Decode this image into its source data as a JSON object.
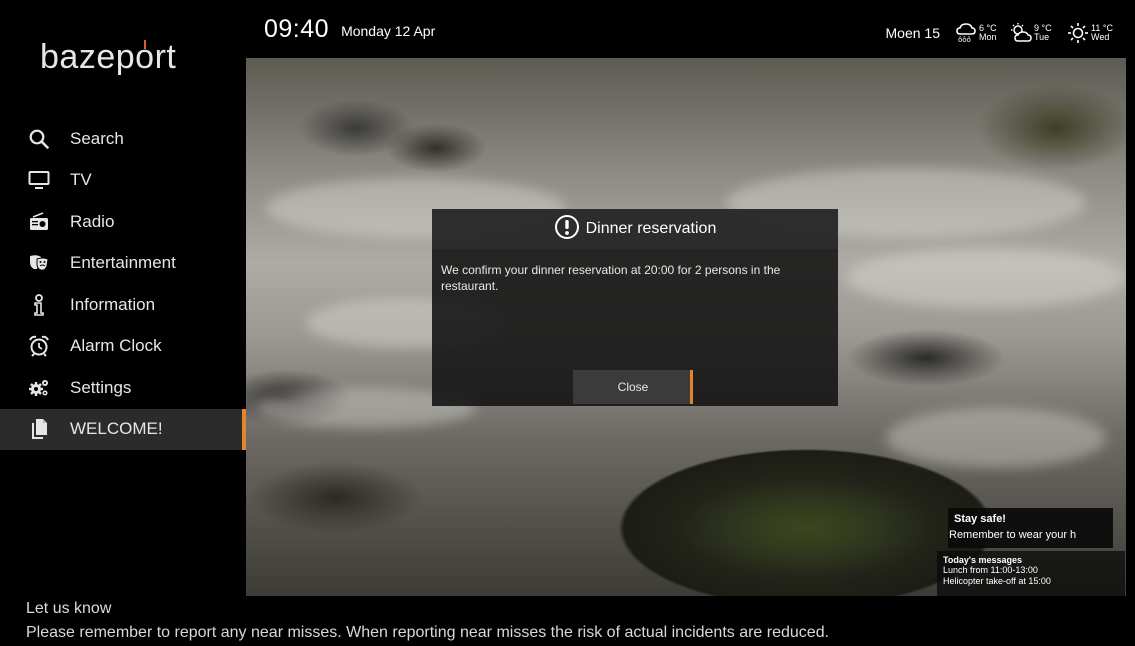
{
  "brand": {
    "logo_text_pre": "bazep",
    "logo_text_o": "o",
    "logo_text_post": "rt"
  },
  "header": {
    "time": "09:40",
    "date": "Monday 12 Apr",
    "room": "Moen 15",
    "weather": [
      {
        "temp": "6 °C",
        "day": "Mon",
        "icon": "cloud-rain-icon"
      },
      {
        "temp": "9 °C",
        "day": "Tue",
        "icon": "sun-cloud-icon"
      },
      {
        "temp": "11 °C",
        "day": "Wed",
        "icon": "sun-icon"
      }
    ]
  },
  "sidebar": {
    "items": [
      {
        "label": "Search",
        "icon": "search-icon"
      },
      {
        "label": "TV",
        "icon": "tv-icon"
      },
      {
        "label": "Radio",
        "icon": "radio-icon"
      },
      {
        "label": "Entertainment",
        "icon": "theater-masks-icon"
      },
      {
        "label": "Information",
        "icon": "information-icon"
      },
      {
        "label": "Alarm Clock",
        "icon": "alarm-clock-icon"
      },
      {
        "label": "Settings",
        "icon": "settings-gears-icon"
      },
      {
        "label": "WELCOME!",
        "icon": "document-icon",
        "active": true
      }
    ]
  },
  "dialog": {
    "title": "Dinner reservation",
    "body": "We confirm your dinner reservation at 20:00 for 2 persons in the restaurant.",
    "close_label": "Close"
  },
  "notice": {
    "title": "Stay safe!",
    "text": "Remember to wear your h"
  },
  "today_messages": {
    "title": "Today's messages",
    "lines": [
      "Lunch from 11:00-13:00",
      "Helicopter take-off at 15:00"
    ]
  },
  "ticker": {
    "title": "Let us know",
    "text": "Please remember to report any near misses. When reporting near misses the risk of actual incidents are reduced."
  },
  "colors": {
    "accent": "#e5852b",
    "active_bg": "#2b2b2b",
    "background": "#000000"
  }
}
